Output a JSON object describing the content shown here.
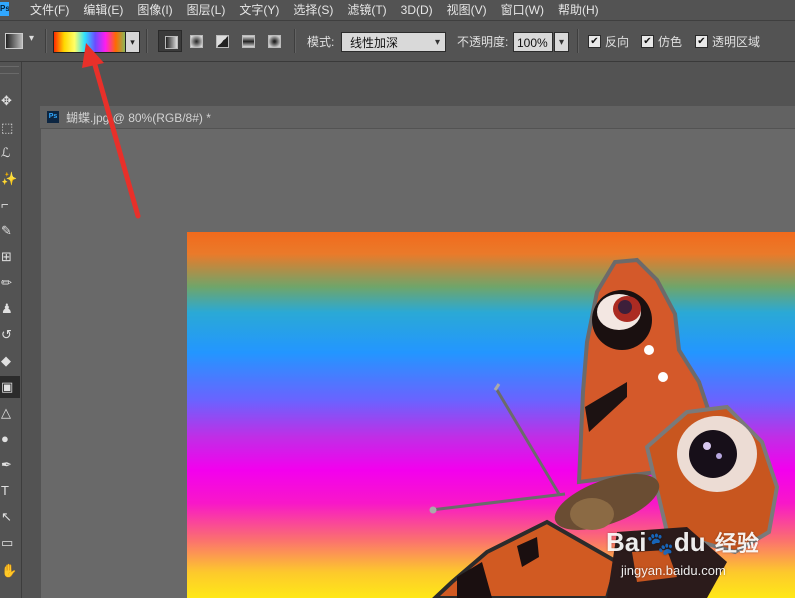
{
  "app": {
    "logo": "Ps"
  },
  "menu": [
    "文件(F)",
    "编辑(E)",
    "图像(I)",
    "图层(L)",
    "文字(Y)",
    "选择(S)",
    "滤镜(T)",
    "3D(D)",
    "视图(V)",
    "窗口(W)",
    "帮助(H)"
  ],
  "options": {
    "gradient_colors": [
      "#ff2a00",
      "#ffd800",
      "#ffff66",
      "#2de0ff",
      "#6a4cff",
      "#ff1cf0",
      "#ff6a00",
      "#7fbf60"
    ],
    "mode_label": "模式:",
    "mode_value": "线性加深",
    "opacity_label": "不透明度:",
    "opacity_value": "100%",
    "reverse_label": "反向",
    "dither_label": "仿色",
    "transparency_label": "透明区域",
    "check_mark": "✔"
  },
  "document": {
    "title": "蝴蝶.jpg @ 80%(RGB/8#) *",
    "ps_icon": "Ps"
  },
  "toolbar": {
    "tools": [
      {
        "name": "move-tool-icon",
        "glyph": "✥"
      },
      {
        "name": "marquee-tool-icon",
        "glyph": "⬚"
      },
      {
        "name": "lasso-tool-icon",
        "glyph": "ℒ"
      },
      {
        "name": "magic-wand-tool-icon",
        "glyph": "✨"
      },
      {
        "name": "crop-tool-icon",
        "glyph": "⌐"
      },
      {
        "name": "eyedropper-tool-icon",
        "glyph": "✎"
      },
      {
        "name": "healing-brush-tool-icon",
        "glyph": "⊞"
      },
      {
        "name": "brush-tool-icon",
        "glyph": "✏"
      },
      {
        "name": "clone-stamp-tool-icon",
        "glyph": "♟"
      },
      {
        "name": "history-brush-tool-icon",
        "glyph": "↺"
      },
      {
        "name": "eraser-tool-icon",
        "glyph": "◆"
      },
      {
        "name": "gradient-tool-icon",
        "glyph": "▣"
      },
      {
        "name": "blur-tool-icon",
        "glyph": "△"
      },
      {
        "name": "dodge-tool-icon",
        "glyph": "●"
      },
      {
        "name": "pen-tool-icon",
        "glyph": "✒"
      },
      {
        "name": "type-tool-icon",
        "glyph": "T"
      },
      {
        "name": "path-selection-tool-icon",
        "glyph": "↖"
      },
      {
        "name": "rectangle-tool-icon",
        "glyph": "▭"
      },
      {
        "name": "hand-tool-icon",
        "glyph": "✋"
      }
    ]
  },
  "watermark": {
    "brand": "Bai",
    "paw": "🐾",
    "brand_suffix": "du",
    "cn": "经验",
    "url": "jingyan.baidu.com"
  },
  "colors": {
    "annotation_arrow": "#e8302a",
    "psBlue": "#31a8ff"
  }
}
